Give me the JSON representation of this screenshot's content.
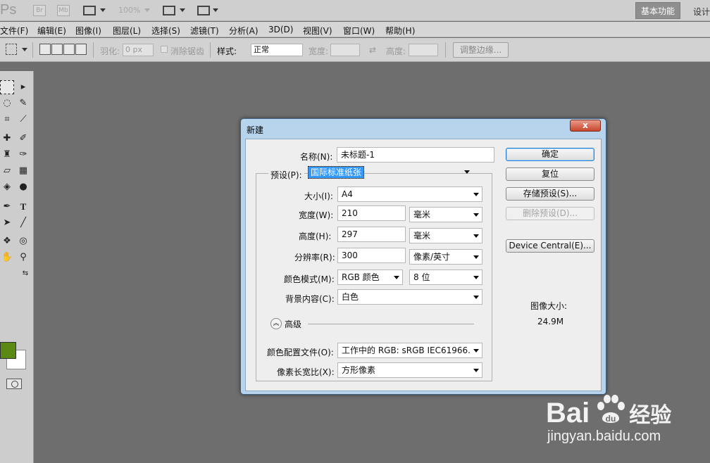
{
  "app": {
    "logo": "Ps",
    "appbar_buttons": [
      "Br",
      "Mb"
    ],
    "zoom": "100%",
    "workspace_active": "基本功能",
    "workspace_next": "设计"
  },
  "menu": [
    "文件(F)",
    "编辑(E)",
    "图像(I)",
    "图层(L)",
    "选择(S)",
    "滤镜(T)",
    "分析(A)",
    "3D(D)",
    "视图(V)",
    "窗口(W)",
    "帮助(H)"
  ],
  "options": {
    "feather_label": "羽化:",
    "feather_value": "0 px",
    "antialias_label": "消除锯齿",
    "style_label": "样式:",
    "style_value": "正常",
    "width_label": "宽度:",
    "height_label": "高度:",
    "refine_edge": "调整边缘..."
  },
  "dialog": {
    "title": "新建",
    "close": "x",
    "name_label": "名称(N):",
    "name_value": "未标题-1",
    "preset_label": "预设(P):",
    "preset_value": "国际标准纸张",
    "size_label": "大小(I):",
    "size_value": "A4",
    "width_label": "宽度(W):",
    "width_value": "210",
    "width_unit": "毫米",
    "height_label": "高度(H):",
    "height_value": "297",
    "height_unit": "毫米",
    "resolution_label": "分辨率(R):",
    "resolution_value": "300",
    "resolution_unit": "像素/英寸",
    "color_mode_label": "颜色模式(M):",
    "color_mode_value": "RGB 颜色",
    "bit_depth": "8 位",
    "background_label": "背景内容(C):",
    "background_value": "白色",
    "advanced_label": "高级",
    "color_profile_label": "颜色配置文件(O):",
    "color_profile_value": "工作中的 RGB: sRGB IEC61966...",
    "pixel_aspect_label": "像素长宽比(X):",
    "pixel_aspect_value": "方形像素",
    "buttons": {
      "ok": "确定",
      "reset": "复位",
      "save_preset": "存储预设(S)...",
      "delete_preset": "删除预设(D)...",
      "device_central": "Device Central(E)..."
    },
    "image_size_label": "图像大小:",
    "image_size_value": "24.9M"
  },
  "colors": {
    "foreground": "#5a8a12",
    "background": "#ffffff",
    "canvas": "#6e6e6e"
  },
  "watermark": {
    "brand": "Bai",
    "brand_tail": "经验",
    "url": "jingyan.baidu.com"
  }
}
